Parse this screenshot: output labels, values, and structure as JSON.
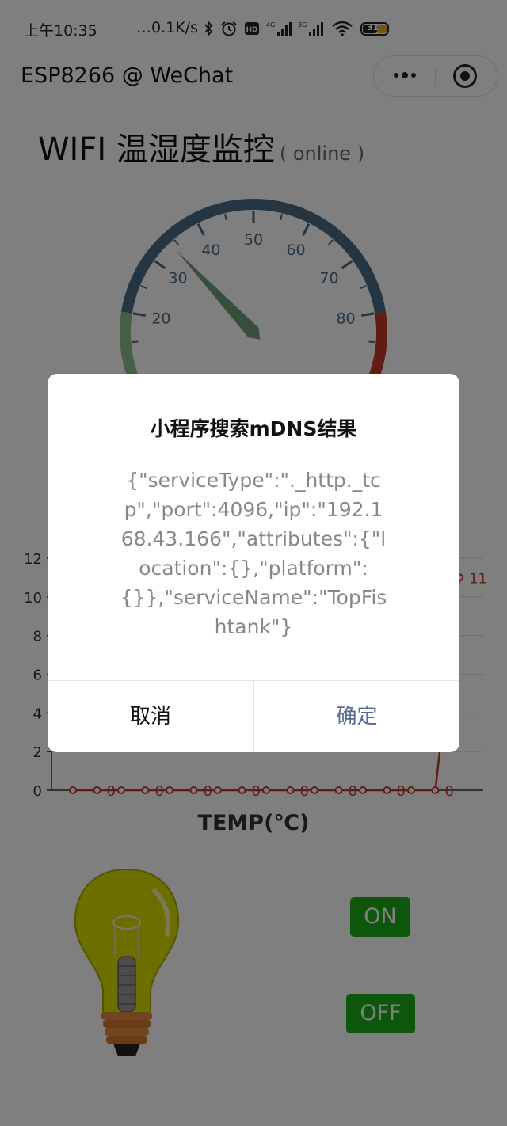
{
  "status_bar": {
    "time": "上午10:35",
    "net_speed": "…0.1K/s",
    "battery_level": "31",
    "icons": [
      "bluetooth-icon",
      "alarm-icon",
      "hd-icon",
      "4g-signal-icon",
      "3g-signal-icon",
      "wifi-icon",
      "battery-icon"
    ]
  },
  "nav": {
    "title": "ESP8266 @ WeChat"
  },
  "page": {
    "heading": "WIFI 温湿度监控",
    "status": "( online )"
  },
  "gauge": {
    "min": 0,
    "max": 100,
    "tick_labels": [
      "20",
      "30",
      "40",
      "50",
      "60",
      "70",
      "80"
    ],
    "tick_values": [
      20,
      30,
      40,
      50,
      60,
      70,
      80
    ],
    "needle_value": 34,
    "green_to": 20,
    "red_from": 80,
    "colors": {
      "arc": "#4b6a82",
      "low": "#8fbf8f",
      "high": "#c0392b",
      "needle": "#6e9d76"
    }
  },
  "chart_data": {
    "type": "line",
    "xlabel": "TEMP(℃)",
    "ylabel": "",
    "ylim": [
      0,
      12
    ],
    "yticks": [
      0,
      2,
      4,
      6,
      8,
      10,
      12
    ],
    "series": [
      {
        "values": [
          0,
          0,
          0,
          0,
          0,
          0,
          0,
          0,
          0,
          0,
          0,
          0,
          0,
          0,
          0,
          0,
          11
        ]
      }
    ],
    "point_labels": [
      "0",
      "0",
      "0",
      "0",
      "0",
      "0",
      "0",
      "0",
      "11"
    ],
    "color": "#c0392b"
  },
  "controls": {
    "on_label": "ON",
    "off_label": "OFF",
    "button_color": "#1aad19"
  },
  "modal": {
    "title": "小程序搜索mDNS结果",
    "content": "{\"serviceType\":\"._http._tcp\",\"port\":4096,\"ip\":\"192.168.43.166\",\"attributes\":{\"location\":{},\"platform\":{}},\"serviceName\":\"TopFishtank\"}",
    "cancel_label": "取消",
    "confirm_label": "确定",
    "confirm_color": "#576b95"
  }
}
